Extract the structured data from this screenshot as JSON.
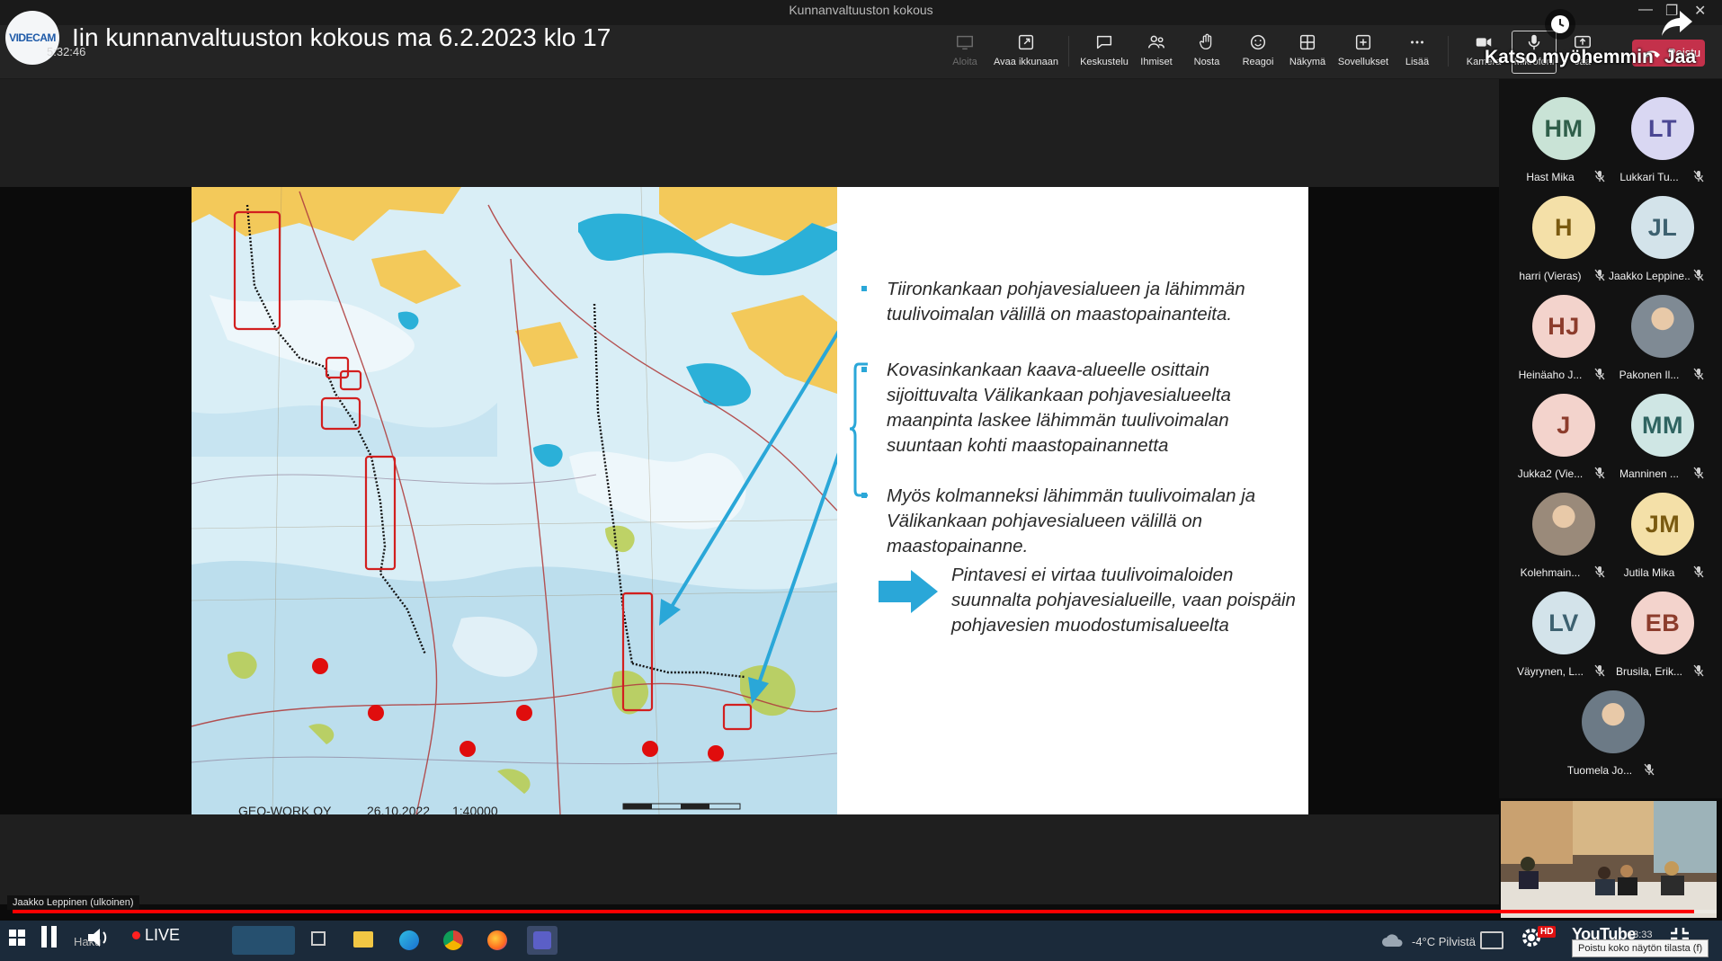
{
  "window": {
    "title": "Kunnanvaltuuston kokous"
  },
  "header": {
    "logo_text": "VIDECAM",
    "meeting_title": "Iin kunnanvaltuuston kokous ma 6.2.2023 klo 17",
    "elapsed_time": "5:32:46"
  },
  "toolbar": {
    "items": [
      {
        "label": "Aloita",
        "icon": "present-icon",
        "enabled": false
      },
      {
        "label": "Avaa ikkunaan",
        "icon": "popout-icon"
      },
      {
        "label": "Keskustelu",
        "icon": "chat-icon"
      },
      {
        "label": "Ihmiset",
        "icon": "people-icon"
      },
      {
        "label": "Nosta",
        "icon": "raise-hand-icon"
      },
      {
        "label": "Reagoi",
        "icon": "reaction-icon"
      },
      {
        "label": "Näkymä",
        "icon": "view-grid-icon"
      },
      {
        "label": "Sovellukset",
        "icon": "apps-plus-icon"
      },
      {
        "label": "Lisää",
        "icon": "more-icon"
      },
      {
        "label": "Kamera",
        "icon": "camera-icon"
      },
      {
        "label": "Mikrofoni",
        "icon": "microphone-icon"
      },
      {
        "label": "Jaa",
        "icon": "share-tray-icon"
      }
    ],
    "leave_label": "Poistu"
  },
  "youtube_overlay": {
    "watch_later": "Katso myöhemmin",
    "share": "Jaa"
  },
  "slide": {
    "map_credit": {
      "company": "GEO-WORK OY",
      "date": "26.10.2022",
      "scale": "1:40000"
    },
    "bullets": [
      "Tiironkankaan pohjavesialueen ja lähimmän tuulivoimalan välillä on maastopainanteita.",
      "Kovasinkankaan kaava-alueelle osittain sijoittuvalta Välikankaan pohjavesialueelta maanpinta laskee lähimmän tuulivoimalan suuntaan kohti maastopainannetta",
      "Myös kolmanneksi lähimmän tuulivoimalan ja Välikankaan pohjavesialueen välillä on maastopainanne."
    ],
    "callout": "Pintavesi ei virtaa tuulivoimaloiden suunnalta pohjavesialueille, vaan poispäin pohjavesien muodostumisalueelta",
    "accent_color": "#2aa7d8"
  },
  "participants": [
    {
      "initials": "HM",
      "name": "Hast Mika",
      "bg": "#c9e3d6",
      "fg": "#2f5f4a"
    },
    {
      "initials": "LT",
      "name": "Lukkari Tu...",
      "bg": "#d9d7f2",
      "fg": "#4a4693"
    },
    {
      "initials": "H",
      "name": "harri (Vieras)",
      "bg": "#f4e0a8",
      "fg": "#7a5a10"
    },
    {
      "initials": "JL",
      "name": "Jaakko Leppine...",
      "bg": "#d3e3ea",
      "fg": "#3d6170"
    },
    {
      "initials": "HJ",
      "name": "Heinäaho J...",
      "bg": "#f3d3cc",
      "fg": "#8c3c2c"
    },
    {
      "initials": "",
      "name": "Pakonen Il...",
      "bg": "#7f8a94",
      "fg": "#ffffff",
      "photo": true
    },
    {
      "initials": "J",
      "name": "Jukka2 (Vie...",
      "bg": "#f3d3cc",
      "fg": "#8c3c2c"
    },
    {
      "initials": "MM",
      "name": "Manninen ...",
      "bg": "#cfe6e4",
      "fg": "#2f6461"
    },
    {
      "initials": "",
      "name": "Kolehmain...",
      "bg": "#9a8a7a",
      "fg": "#ffffff",
      "photo": true
    },
    {
      "initials": "JM",
      "name": "Jutila Mika",
      "bg": "#f4e0a8",
      "fg": "#7a5a10"
    },
    {
      "initials": "LV",
      "name": "Väyrynen, L...",
      "bg": "#d3e3ea",
      "fg": "#3d6170"
    },
    {
      "initials": "EB",
      "name": "Brusila, Erik...",
      "bg": "#f3d3cc",
      "fg": "#8c3c2c"
    },
    {
      "initials": "",
      "name": "Tuomela Jo...",
      "bg": "#6c7a86",
      "fg": "#ffffff",
      "photo": true
    }
  ],
  "speaker": {
    "label": "Jaakko Leppinen (ulkoinen)"
  },
  "player": {
    "live_label": "LIVE",
    "progress": 0.987
  },
  "taskbar": {
    "search_label": "Haku",
    "weather": "-4°C  Pilvistä",
    "time": "13:33",
    "youtube_label": "YouTube",
    "hd_label": "HD",
    "tooltip": "Poistu koko näytön tilasta (f)"
  }
}
